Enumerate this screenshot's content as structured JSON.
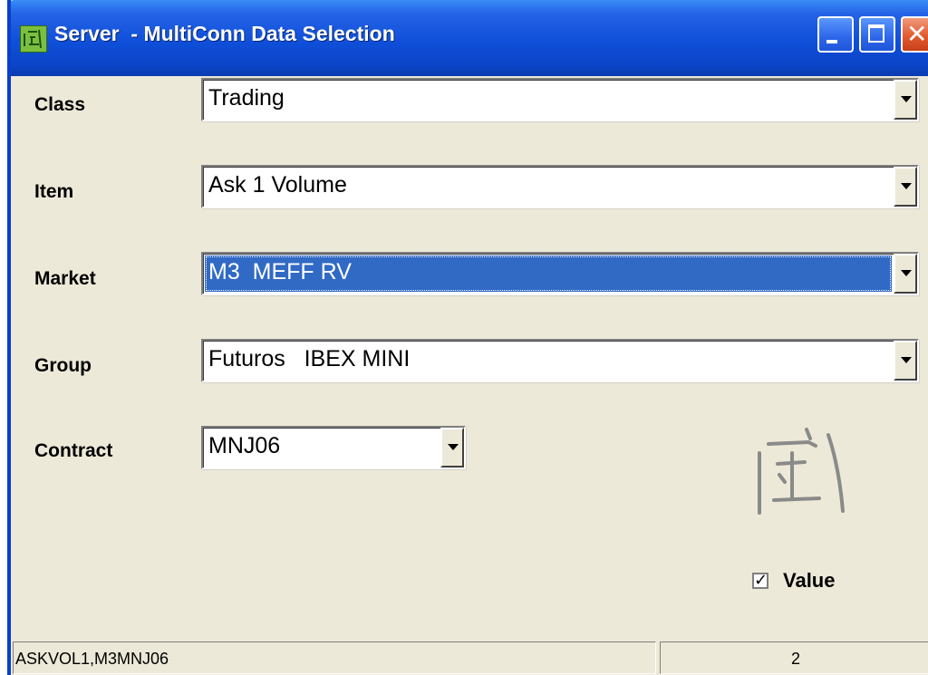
{
  "window": {
    "title": "Server  - MultiConn Data Selection",
    "controls": {
      "minimize": "minimize",
      "maximize": "maximize",
      "close": "close"
    }
  },
  "form": {
    "class": {
      "label": "Class",
      "value": "Trading"
    },
    "item": {
      "label": "Item",
      "value": "Ask 1 Volume"
    },
    "market": {
      "label": "Market",
      "value": "M3  MEFF RV"
    },
    "group": {
      "label": "Group",
      "value": "Futuros   IBEX MINI"
    },
    "contract": {
      "label": "Contract",
      "value": "MNJ06"
    }
  },
  "options": {
    "value_checkbox": {
      "label": "Value",
      "checked": true
    }
  },
  "statusbar": {
    "left": "ASKVOL1,M3MNJ06",
    "right": "2"
  },
  "colors": {
    "titlebar": "#0f4fd9",
    "selection": "#316ac5",
    "dialog_bg": "#ece9d8"
  }
}
